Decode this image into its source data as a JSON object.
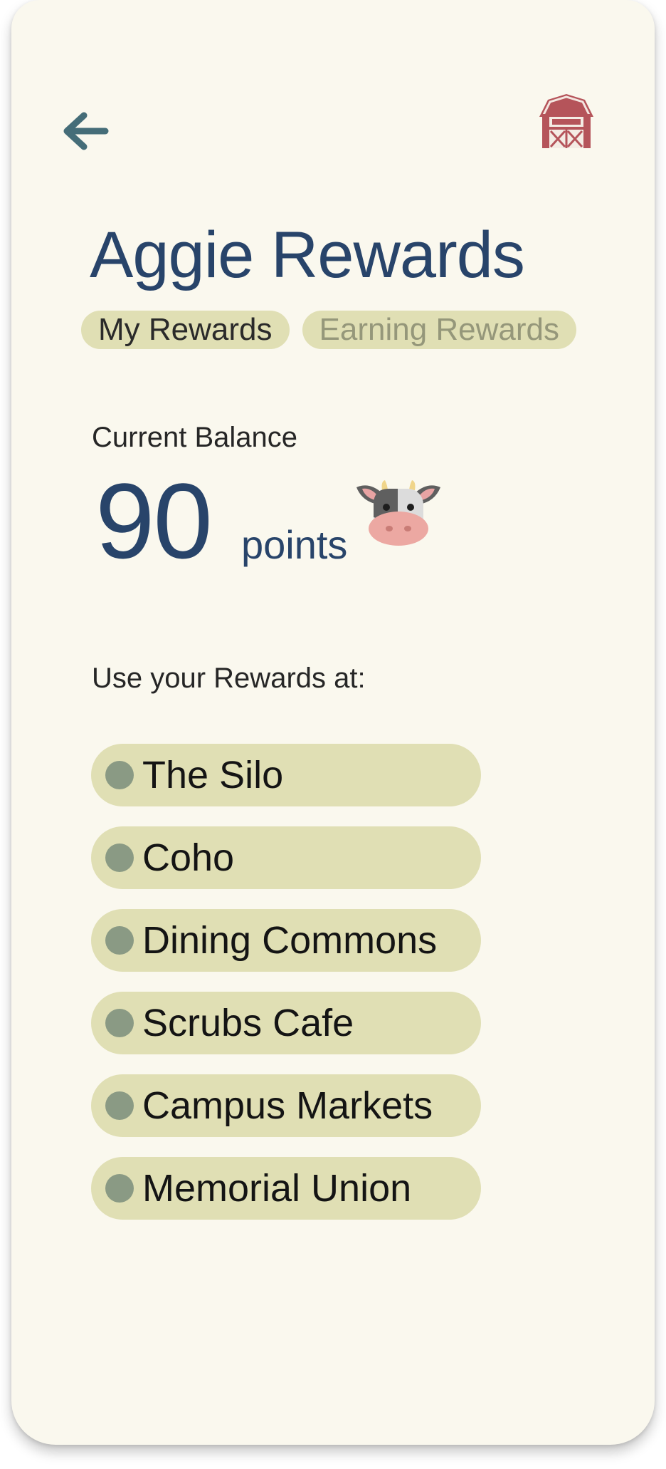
{
  "header": {
    "back_icon": "back-arrow-icon",
    "home_icon": "barn-icon"
  },
  "title": "Aggie Rewards",
  "tabs": [
    {
      "label": "My Rewards",
      "active": true
    },
    {
      "label": "Earning Rewards",
      "active": false
    }
  ],
  "balance": {
    "label": "Current Balance",
    "value": "90",
    "unit": "points",
    "icon": "cow-icon"
  },
  "locations": {
    "label": "Use your Rewards at:",
    "items": [
      "The Silo",
      "Coho",
      "Dining Commons",
      "Scrubs Cafe",
      "Campus Markets",
      "Memorial Union"
    ]
  },
  "colors": {
    "background": "#faf8ee",
    "primary": "#28446a",
    "pill": "#e0dfb4",
    "dot": "#8a9a84",
    "barn": "#b5545a",
    "back_arrow": "#456d78"
  }
}
